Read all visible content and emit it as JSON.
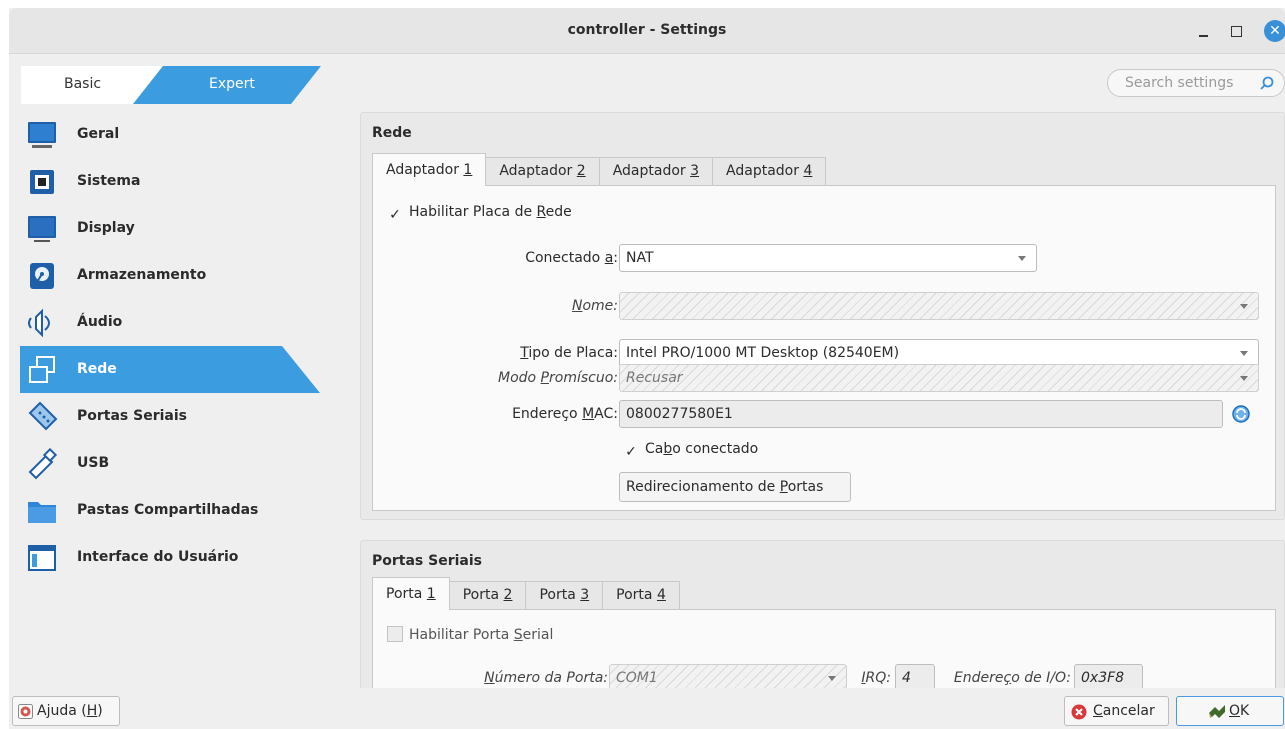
{
  "window": {
    "title": "controller - Settings"
  },
  "mode": {
    "basic": "Basic",
    "expert": "Expert",
    "selected": "Expert"
  },
  "search": {
    "placeholder": "Search settings"
  },
  "sidebar": {
    "selected": "Rede",
    "items": [
      {
        "label": "Geral",
        "icon": "monitor-icon"
      },
      {
        "label": "Sistema",
        "icon": "chip-icon"
      },
      {
        "label": "Display",
        "icon": "display-icon"
      },
      {
        "label": "Armazenamento",
        "icon": "storage-icon"
      },
      {
        "label": "Áudio",
        "icon": "speaker-icon"
      },
      {
        "label": "Rede",
        "icon": "network-icon"
      },
      {
        "label": "Portas Seriais",
        "icon": "serial-port-icon"
      },
      {
        "label": "USB",
        "icon": "usb-icon"
      },
      {
        "label": "Pastas Compartilhadas",
        "icon": "folder-icon"
      },
      {
        "label": "Interface do Usuário",
        "icon": "window-icon"
      }
    ]
  },
  "network": {
    "title": "Rede",
    "tabs": [
      {
        "label": "Adaptador ",
        "key": "1"
      },
      {
        "label": "Adaptador ",
        "key": "2"
      },
      {
        "label": "Adaptador ",
        "key": "3"
      },
      {
        "label": "Adaptador ",
        "key": "4"
      }
    ],
    "active_tab": "Adaptador 1",
    "enable_label_pre": "Habilitar Placa de ",
    "enable_label_key": "R",
    "enable_label_post": "ede",
    "enable_checked": true,
    "attached_label_pre": "Conectado ",
    "attached_label_key": "a",
    "attached_label_post": ":",
    "attached_value": "NAT",
    "name_label_key": "N",
    "name_label_post": "ome:",
    "name_value": "",
    "adapter_type_label_key": "T",
    "adapter_type_label_post": "ipo de Placa:",
    "adapter_type_value": "Intel PRO/1000 MT Desktop (82540EM)",
    "promisc_label_pre": "Modo ",
    "promisc_label_key": "P",
    "promisc_label_post": "romíscuo:",
    "promisc_value": "Recusar",
    "mac_label_pre": "Endereço ",
    "mac_label_key": "M",
    "mac_label_post": "AC:",
    "mac_value": "0800277580E1",
    "cable_label_pre": "Ca",
    "cable_label_key": "b",
    "cable_label_post": "o conectado",
    "cable_checked": true,
    "port_fwd_pre": "Redirecionamento de ",
    "port_fwd_key": "P",
    "port_fwd_post": "ortas"
  },
  "serial": {
    "title": "Portas Seriais",
    "tabs": [
      {
        "label": "Porta ",
        "key": "1"
      },
      {
        "label": "Porta ",
        "key": "2"
      },
      {
        "label": "Porta ",
        "key": "3"
      },
      {
        "label": "Porta ",
        "key": "4"
      }
    ],
    "active_tab": "Porta 1",
    "enable_label_pre": "Habilitar Porta ",
    "enable_label_key": "S",
    "enable_label_post": "erial",
    "enable_checked": false,
    "port_number_label_key": "N",
    "port_number_label_post": "úmero da Porta:",
    "port_number_value": "COM1",
    "irq_label_key": "I",
    "irq_label_post": "RQ:",
    "irq_value": "4",
    "io_label_pre": "Endere",
    "io_label_key": "ç",
    "io_label_post": "o de I/O:",
    "io_value": "0x3F8"
  },
  "footer": {
    "help_pre": "Ajuda (",
    "help_key": "H",
    "help_post": ")",
    "cancel_key": "C",
    "cancel_post": "ancelar",
    "ok_pre": "",
    "ok_key": "O",
    "ok_post": "K"
  }
}
